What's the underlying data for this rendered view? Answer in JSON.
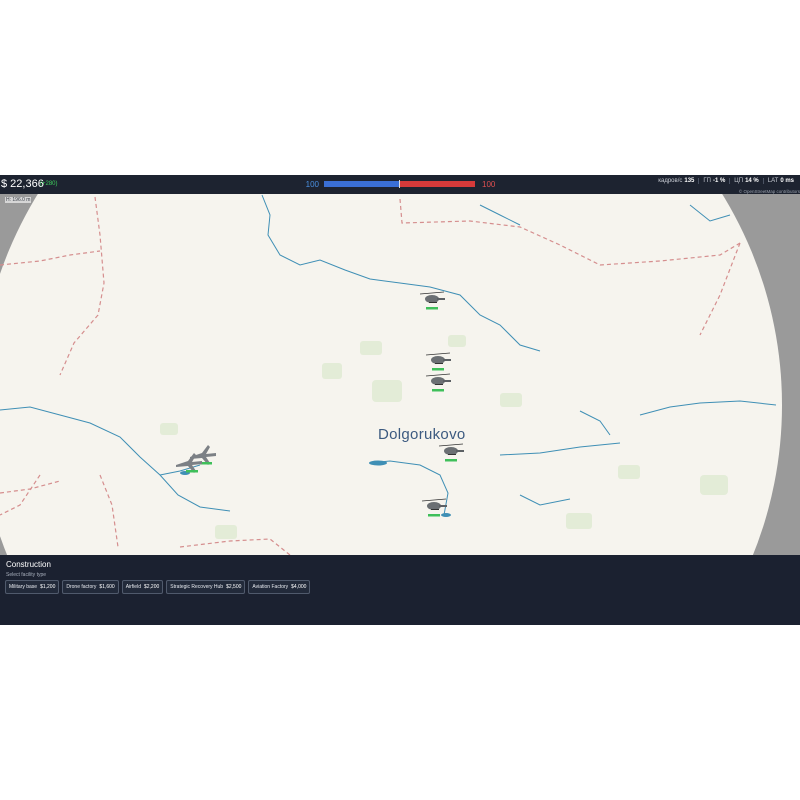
{
  "hud": {
    "money": "$ 22,366",
    "income": "(+280)",
    "score_blue": "100",
    "score_red": "100",
    "balance_blue_fraction": 0.5,
    "stats": [
      {
        "label": "кадров/с",
        "value": "135"
      },
      {
        "label": "ГП",
        "value": "-1 %"
      },
      {
        "label": "ЦП",
        "value": "14 %"
      },
      {
        "label": "LAT",
        "value": "0 ms"
      }
    ],
    "attribution": "© OpenStreetMap contributors",
    "altitude": "H: 196.0 m"
  },
  "map": {
    "city_label": "Dolgorukovo",
    "colors": {
      "land": "#f6f4ee",
      "river": "#3f8fb5",
      "border": "#d58e8e",
      "outside": "#9a9a9a",
      "green": "#e3ecd7"
    }
  },
  "units": [
    {
      "type": "helicopter-icon"
    },
    {
      "type": "helicopter-icon"
    },
    {
      "type": "helicopter-icon"
    },
    {
      "type": "helicopter-icon"
    },
    {
      "type": "helicopter-icon"
    },
    {
      "type": "jet-icon"
    },
    {
      "type": "jet-icon"
    }
  ],
  "construction": {
    "title": "Construction",
    "subtitle": "Select facility type",
    "facilities": [
      {
        "name": "Military base",
        "price": "$1,200"
      },
      {
        "name": "Drone factory",
        "price": "$1,600"
      },
      {
        "name": "Airfield",
        "price": "$2,200"
      },
      {
        "name": "Strategic Recovery Hub",
        "price": "$2,500"
      },
      {
        "name": "Aviation Factory",
        "price": "$4,000"
      }
    ]
  }
}
